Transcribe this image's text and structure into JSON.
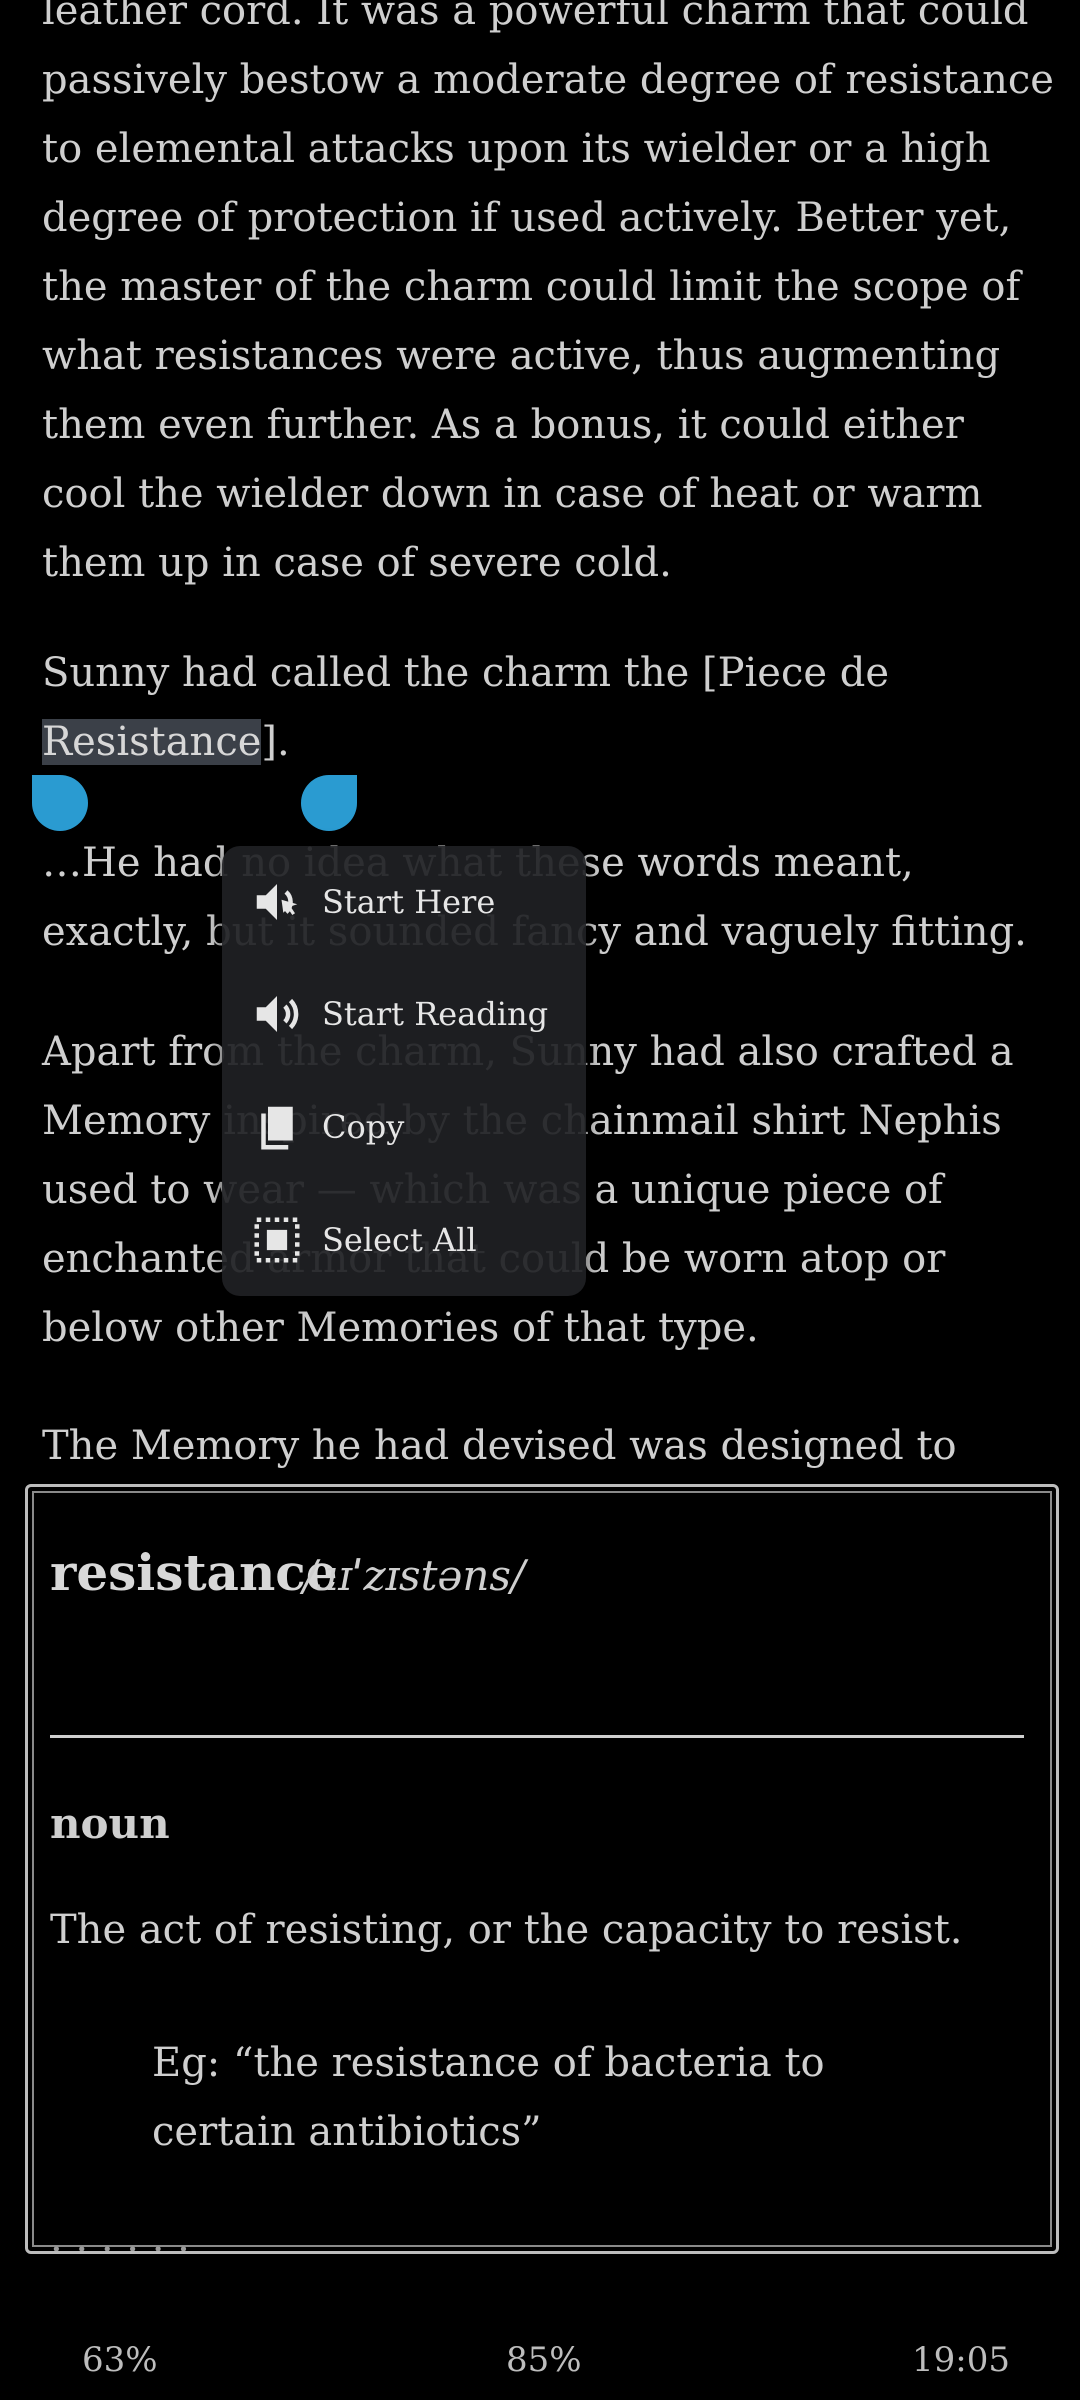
{
  "reader": {
    "para1": [
      "leather cord. It was a powerful charm that could",
      "passively bestow a moderate degree of resistance",
      "to elemental attacks upon its wielder or a high",
      "degree of protection if used actively. Better yet,",
      "the master of the charm could limit the scope of",
      "what resistances were active, thus augmenting",
      "them even further. As a bonus, it could either",
      "cool the wielder down in case of heat or warm",
      "them up in case of severe cold."
    ],
    "para2_line1": "Sunny had called the charm the [Piece de",
    "para2_selected": "Resistance",
    "para2_after": "].",
    "para3": [
      "…He had no idea what these words meant,",
      "exactly, but it sounded fancy and vaguely fitting."
    ],
    "para4": [
      "Apart from the charm, Sunny had also crafted a",
      "Memory inspired by the chainmail shirt Nephis",
      "used to wear — which was a unique piece of",
      "enchanted armor that could be worn atop or",
      "below other Memories of that type."
    ],
    "para5": "The Memory he had devised was designed to"
  },
  "context_menu": {
    "items": [
      {
        "label": "Start Here",
        "icon": "speaker-cursor-icon"
      },
      {
        "label": "Start Reading",
        "icon": "speaker-icon"
      },
      {
        "label": "Copy",
        "icon": "copy-icon"
      },
      {
        "label": "Select All",
        "icon": "select-all-icon"
      }
    ]
  },
  "dictionary": {
    "word": "resistance",
    "pronunciation": "/ɹɪˈzɪstəns/",
    "part_of_speech": "noun",
    "definition": "The act of resisting, or the capacity to resist.",
    "example_lines": [
      "Eg: “the resistance of bacteria to",
      "certain antibiotics”"
    ],
    "truncated_text": ". . .  . . ."
  },
  "status_bar": {
    "battery": "63%",
    "progress": "85%",
    "time": "19:05"
  },
  "colors": {
    "selection_handle": "#2a9bd1",
    "selection_bg": "#3b4048",
    "menu_bg": "#202124"
  }
}
